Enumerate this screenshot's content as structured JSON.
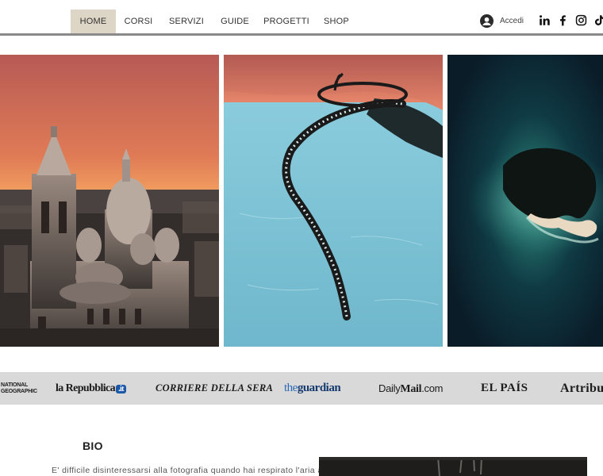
{
  "nav": {
    "items": [
      {
        "label": "HOME",
        "active": true
      },
      {
        "label": "CORSI",
        "active": false
      },
      {
        "label": "SERVIZI",
        "active": false
      },
      {
        "label": "GUIDE",
        "active": false
      },
      {
        "label": "PROGETTI",
        "active": false
      },
      {
        "label": "SHOP",
        "active": false
      }
    ]
  },
  "login": {
    "label": "Accedi",
    "icon": "user-avatar-icon"
  },
  "social": {
    "icons": [
      "linkedin-icon",
      "facebook-icon",
      "instagram-icon",
      "tiktok-icon"
    ]
  },
  "gallery": {
    "photos": [
      {
        "subject": "sacre-coeur-basilica-sunset",
        "icon": "photo"
      },
      {
        "subject": "serpent-skeleton-sculpture-aerial",
        "icon": "photo"
      },
      {
        "subject": "island-aerial-turquoise-sea",
        "icon": "photo"
      }
    ]
  },
  "press": {
    "natgeo_line1": "NATIONAL",
    "natgeo_line2": "GEOGRAPHIC",
    "repubblica": "la Repubblica",
    "repubblica_tld": ".it",
    "corriere": "CORRIERE DELLA SERA",
    "guardian_the": "the",
    "guardian_name": "guardian",
    "dailymail_daily": "Daily",
    "dailymail_mail": "Mail",
    "dailymail_com": ".com",
    "elpais": "EL PAÍS",
    "artribune": "Artribu"
  },
  "bio": {
    "title": "BIO",
    "text": "E' difficile disinteressarsi alla fotografia quando hai respirato l'aria acre"
  },
  "colors": {
    "active_tab": "#ddd5c6",
    "header_rule": "#8a8a8a",
    "press_band": "#dad9d9",
    "guardian_blue": "#163b6f",
    "repubblica_blue": "#1b58a7"
  }
}
